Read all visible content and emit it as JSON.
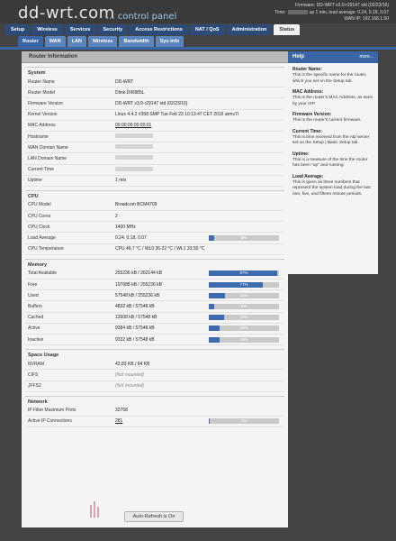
{
  "header": {
    "logo": "dd-wrt.com",
    "subtitle": "... control panel",
    "firmware_line": "Firmware: DD-WRT v3.0-r29147 std (02/23/16)",
    "time_prefix": "Time:",
    "time_suffix": "up 1 min, load average: 0.24, 0.18, 0.07",
    "wan_line": "WAN IP: 192.168.1.50"
  },
  "main_tabs": [
    "Setup",
    "Wireless",
    "Services",
    "Security",
    "Access Restrictions",
    "NAT / QoS",
    "Administration",
    "Status"
  ],
  "sub_tabs": [
    "Router",
    "WAN",
    "LAN",
    "Wireless",
    "Bandwidth",
    "Sys-Info"
  ],
  "panel_title": "Router Information",
  "system": {
    "title": "System",
    "rows": [
      {
        "label": "Router Name",
        "value": "DD-WRT"
      },
      {
        "label": "Router Model",
        "value": "Dlink-DIR885L"
      },
      {
        "label": "Firmware Version",
        "value": "DD-WRT v3.0-r29147 std (02/23/16)"
      },
      {
        "label": "Kernel Version",
        "value": "Linux 4.4.2 #358 SMP Tue Feb 23 10:13:47 CET 2016 armv7l"
      },
      {
        "label": "MAC Address",
        "value": "00:00:00:00:00:01"
      },
      {
        "label": "Hostname",
        "value": ""
      },
      {
        "label": "WAN Domain Name",
        "value": ""
      },
      {
        "label": "LAN Domain Name",
        "value": ""
      },
      {
        "label": "Current Time",
        "value": ""
      },
      {
        "label": "Uptime",
        "value": "1 min"
      }
    ]
  },
  "cpu": {
    "title": "CPU",
    "rows": [
      {
        "label": "CPU Model",
        "value": "Broadcom BCM4709"
      },
      {
        "label": "CPU Cores",
        "value": "2"
      },
      {
        "label": "CPU Clock",
        "value": "1400 MHz"
      },
      {
        "label": "Load Average",
        "value": "0.24, 0.18, 0.07",
        "bar": 0.08,
        "bar_text": "8%"
      },
      {
        "label": "CPU Temperature",
        "value": "CPU 49.7 °C / WL0 36.22 °C / WL1 33.50 °C"
      }
    ]
  },
  "memory": {
    "title": "Memory",
    "rows": [
      {
        "label": "Total Available",
        "value": "255236 kB / 262144 kB",
        "bar": 0.97,
        "bar_text": "97%"
      },
      {
        "label": "Free",
        "value": "197688 kB / 255236 kB",
        "bar": 0.77,
        "bar_text": "77%"
      },
      {
        "label": "Used",
        "value": "57548 kB / 255236 kB",
        "bar": 0.23,
        "bar_text": "23%"
      },
      {
        "label": "Buffers",
        "value": "4832 kB / 57548 kB",
        "bar": 0.08,
        "bar_text": "8%"
      },
      {
        "label": "Cached",
        "value": "12608 kB / 57548 kB",
        "bar": 0.22,
        "bar_text": "22%"
      },
      {
        "label": "Active",
        "value": "9384 kB / 57548 kB",
        "bar": 0.16,
        "bar_text": "16%"
      },
      {
        "label": "Inactive",
        "value": "9332 kB / 57548 kB",
        "bar": 0.16,
        "bar_text": "16%"
      }
    ]
  },
  "space": {
    "title": "Space Usage",
    "rows": [
      {
        "label": "NVRAM",
        "value": "42.83 KB / 64 KB"
      },
      {
        "label": "CIFS",
        "value": "(Not mounted)"
      },
      {
        "label": "JFFS2",
        "value": "(Not mounted)"
      }
    ]
  },
  "network": {
    "title": "Network",
    "rows": [
      {
        "label": "IP Filter Maximum Ports",
        "value": "32768"
      },
      {
        "label": "Active IP Connections",
        "value": "281",
        "bar": 0.01,
        "bar_text": "1%"
      }
    ]
  },
  "auto_refresh": "Auto-Refresh is On",
  "help": {
    "title": "Help",
    "more": "more...",
    "items": [
      {
        "h": "Router Name:",
        "p": "This is the specific name for the router, which you set on the Setup tab."
      },
      {
        "h": "MAC Address:",
        "p": "This is the router's MAC Address, as seen by your ISP."
      },
      {
        "h": "Firmware Version:",
        "p": "This is the router's current firmware."
      },
      {
        "h": "Current Time:",
        "p": "This is time received from the ntp server set on the Setup | Basic Setup tab."
      },
      {
        "h": "Uptime:",
        "p": "This is a measure of the time the router has been \"up\" and running."
      },
      {
        "h": "Load Average:",
        "p": "This is given as three numbers that represent the system load during the last one, five, and fifteen minute periods."
      }
    ]
  },
  "colors": {
    "accent": "#3a66a8",
    "tab_dark": "#2c4b78",
    "bar_fill": "#3c6bb0"
  }
}
